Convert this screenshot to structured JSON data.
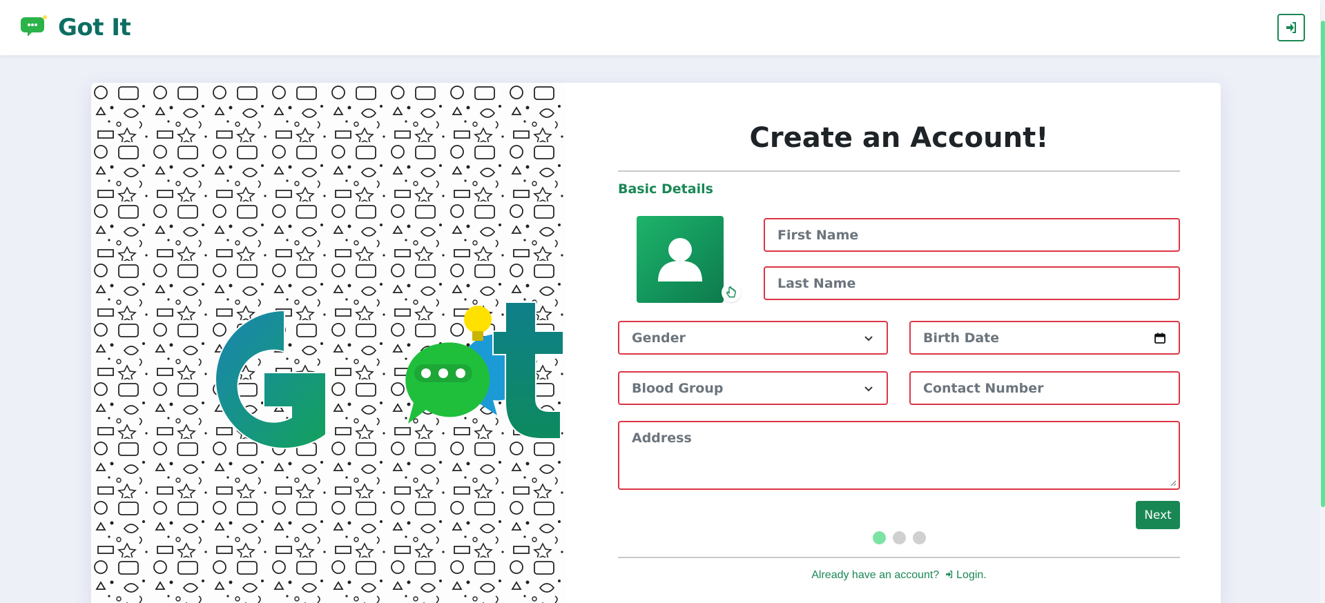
{
  "app": {
    "name": "Got It"
  },
  "header": {
    "login_icon": "sign-in-icon"
  },
  "colors": {
    "accent": "#198754",
    "brand": "#0d6e63",
    "error_border": "#dc3545",
    "page_bg": "#eef0f8"
  },
  "form": {
    "title": "Create an Account!",
    "section": "Basic Details",
    "avatar_icon": "user-icon",
    "first_name": {
      "placeholder": "First Name"
    },
    "last_name": {
      "placeholder": "Last Name"
    },
    "gender": {
      "selected": "Gender"
    },
    "birth_date": {
      "placeholder": "Birth Date"
    },
    "blood_group": {
      "selected": "Blood Group"
    },
    "contact_number": {
      "placeholder": "Contact Number"
    },
    "address": {
      "placeholder": "Address"
    },
    "next_label": "Next",
    "step": {
      "current": 1,
      "total": 3
    }
  },
  "footer": {
    "prompt": "Already have an account?",
    "login_label": "Login."
  }
}
